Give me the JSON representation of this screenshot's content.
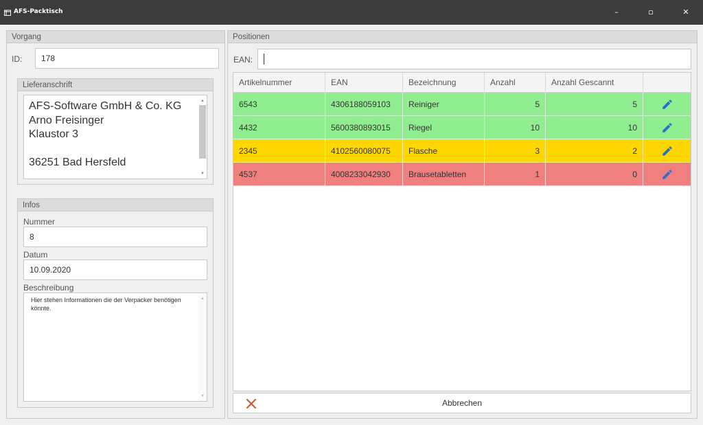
{
  "window": {
    "title": "AFS-Packtisch",
    "minimize": "–",
    "maximize": "▫",
    "close": "✕"
  },
  "vorgang": {
    "header": "Vorgang",
    "id_label": "ID:",
    "id_value": "178",
    "lieferanschrift": {
      "header": "Lieferanschrift",
      "address": "AFS-Software GmbH & Co. KG\nArno Freisinger\nKlaustor 3\n\n36251 Bad Hersfeld"
    },
    "infos": {
      "header": "Infos",
      "nummer_label": "Nummer",
      "nummer_value": "8",
      "datum_label": "Datum",
      "datum_value": "10.09.2020",
      "beschreibung_label": "Beschreibung",
      "beschreibung_value": "Hier stehen Informationen die der Verpacker benötigen könnte."
    }
  },
  "positionen": {
    "header": "Positionen",
    "ean_label": "EAN:",
    "ean_value": "",
    "columns": [
      "Artikelnummer",
      "EAN",
      "Bezeichnung",
      "Anzahl",
      "Anzahl Gescannt"
    ],
    "rows": [
      {
        "artikelnummer": "6543",
        "ean": "4306188059103",
        "bezeichnung": "Reiniger",
        "anzahl": "5",
        "gescannt": "5",
        "color": "#90ee90"
      },
      {
        "artikelnummer": "4432",
        "ean": "5600380893015",
        "bezeichnung": "Riegel",
        "anzahl": "10",
        "gescannt": "10",
        "color": "#90ee90"
      },
      {
        "artikelnummer": "2345",
        "ean": "4102560080075",
        "bezeichnung": "Flasche",
        "anzahl": "3",
        "gescannt": "2",
        "color": "#ffd700"
      },
      {
        "artikelnummer": "4537",
        "ean": "4008233042930",
        "bezeichnung": "Brausetabletten",
        "anzahl": "1",
        "gescannt": "0",
        "color": "#f08080"
      }
    ],
    "edit_icon": "pencil-icon",
    "edit_icon_color": "#2a6fc9"
  },
  "cancel": {
    "label": "Abbrechen",
    "icon": "x-icon",
    "icon_color": "#d9573a"
  }
}
